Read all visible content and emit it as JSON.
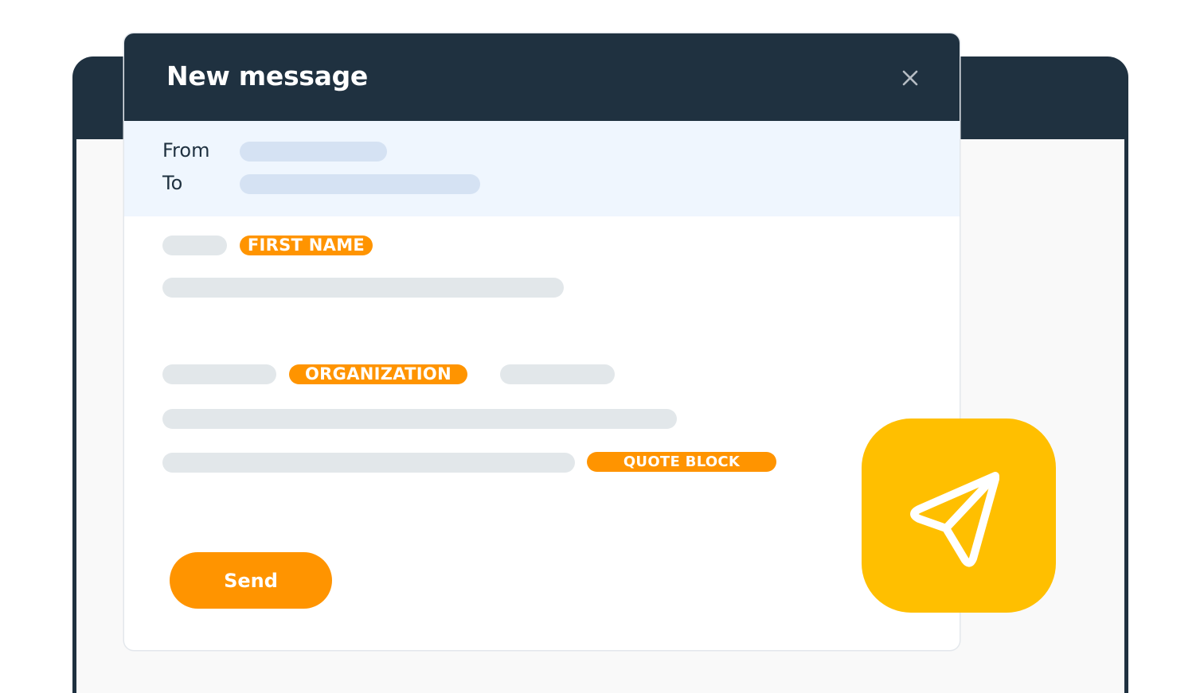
{
  "window": {
    "title": "New message",
    "close_icon": "close-icon"
  },
  "address": {
    "from_label": "From",
    "to_label": "To",
    "from_value": "",
    "to_value": ""
  },
  "body": {
    "tags": {
      "first_name": "FIRST NAME",
      "organization": "ORGANIZATION",
      "quote_block": "QUOTE BLOCK"
    }
  },
  "actions": {
    "send_label": "Send",
    "send_icon": "paper-plane-icon"
  },
  "colors": {
    "header_dark": "#1f3140",
    "accent_orange": "#ff9400",
    "badge_yellow": "#ffbf00",
    "address_bg": "#eff6fe",
    "address_field": "#d5e2f3",
    "placeholder_gray": "#e2e7ea"
  }
}
